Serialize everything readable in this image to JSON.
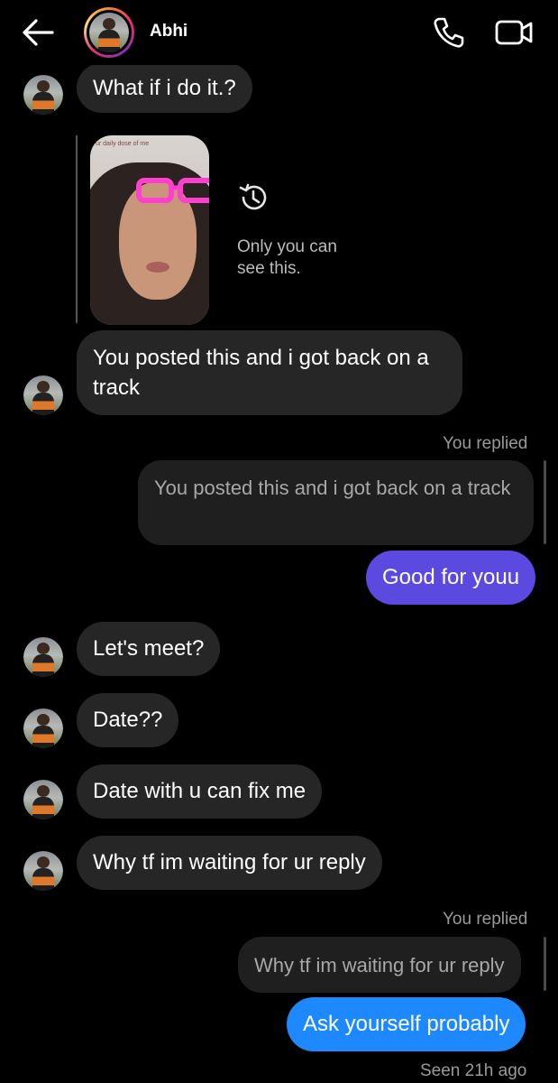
{
  "header": {
    "contact_name": "Abhi",
    "icons": [
      "back-arrow-icon",
      "phone-icon",
      "video-camera-icon"
    ]
  },
  "story_reply": {
    "caption": "ur daily dose of me",
    "status_text": "Only you can see this.",
    "icon": "history-icon"
  },
  "messages": {
    "m1": "What if i do it.?",
    "m2": "You posted this and i got back on a track",
    "replied_label_1": "You replied",
    "quote_1": "You posted this and i got back on a track",
    "m3": "Good for youu",
    "m4": "Let's meet?",
    "m5": "Date??",
    "m6": "Date with u can fix me",
    "m7": "Why tf im waiting for ur reply",
    "replied_label_2": "You replied",
    "quote_2": "Why tf im waiting for ur reply",
    "m8": "Ask yourself probably",
    "seen_status": "Seen 21h ago"
  },
  "colors": {
    "incoming_bubble": "#262626",
    "outgoing_purple": "#5b49e0",
    "outgoing_blue": "#1e88ff",
    "background": "#000000"
  }
}
